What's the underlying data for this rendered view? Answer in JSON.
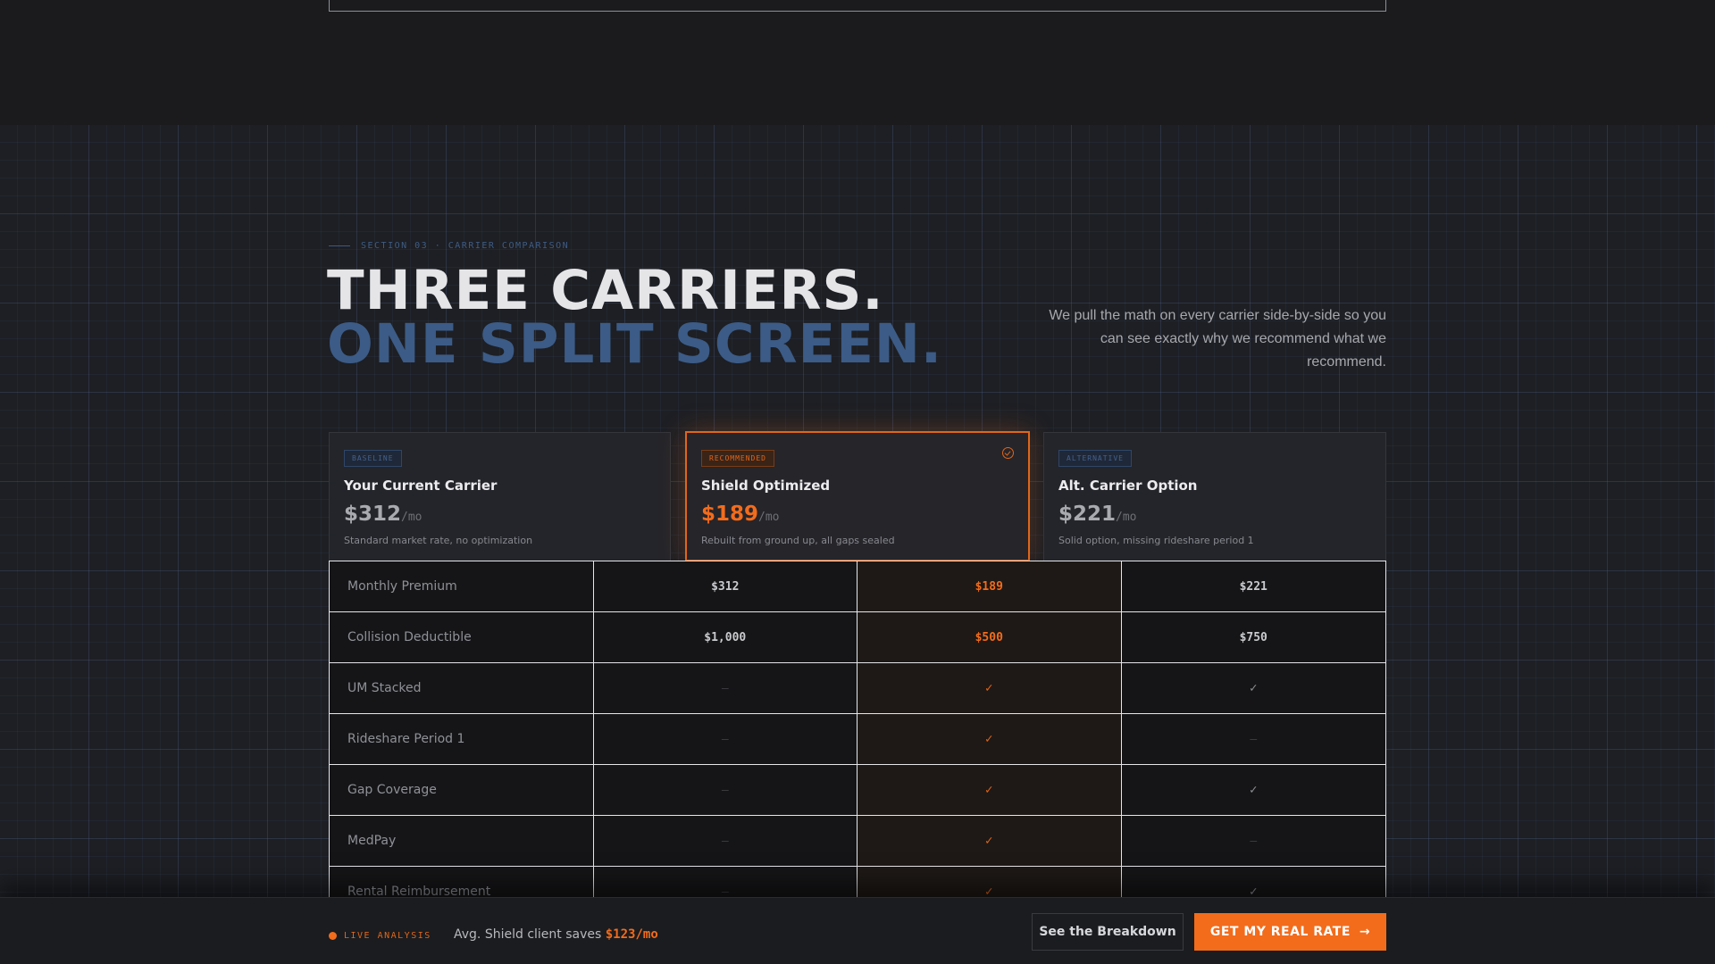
{
  "section": {
    "eyebrow": "SECTION 03 · CARRIER COMPARISON",
    "headline_line1": "THREE CARRIERS.",
    "headline_line2": "ONE SPLIT SCREEN.",
    "intro": "We pull the math on every carrier side-by-side so you can see exactly why we recommend what we recommend."
  },
  "cards": [
    {
      "badge": "BASELINE",
      "name": "Your Current Carrier",
      "price": "$312",
      "per": "/mo",
      "desc": "Standard market rate, no optimization"
    },
    {
      "badge": "RECOMMENDED",
      "name": "Shield Optimized",
      "price": "$189",
      "per": "/mo",
      "desc": "Rebuilt from ground up, all gaps sealed"
    },
    {
      "badge": "ALTERNATIVE",
      "name": "Alt. Carrier Option",
      "price": "$221",
      "per": "/mo",
      "desc": "Solid option, missing rideshare period 1"
    }
  ],
  "table": {
    "rows": [
      {
        "label": "Monthly Premium",
        "c1": "$312",
        "c2": "$189",
        "c3": "$221"
      },
      {
        "label": "Collision Deductible",
        "c1": "$1,000",
        "c2": "$500",
        "c3": "$750"
      },
      {
        "label": "UM Stacked",
        "c1": "—",
        "c2": "✓",
        "c3": "✓"
      },
      {
        "label": "Rideshare Period 1",
        "c1": "—",
        "c2": "✓",
        "c3": "—"
      },
      {
        "label": "Gap Coverage",
        "c1": "—",
        "c2": "✓",
        "c3": "✓"
      },
      {
        "label": "MedPay",
        "c1": "—",
        "c2": "✓",
        "c3": "—"
      },
      {
        "label": "Rental Reimbursement",
        "c1": "—",
        "c2": "✓",
        "c3": "✓"
      }
    ]
  },
  "bottom_bar": {
    "live_label": "LIVE ANALYSIS",
    "savings_prefix": "Avg. Shield client saves",
    "savings_amount": "$123/mo",
    "secondary_button": "See the Breakdown",
    "primary_button": "GET MY REAL RATE",
    "primary_arrow": "→"
  },
  "colors": {
    "accent": "#f26c1c",
    "blue": "#3c5b86",
    "background": "#1b1b1d"
  }
}
